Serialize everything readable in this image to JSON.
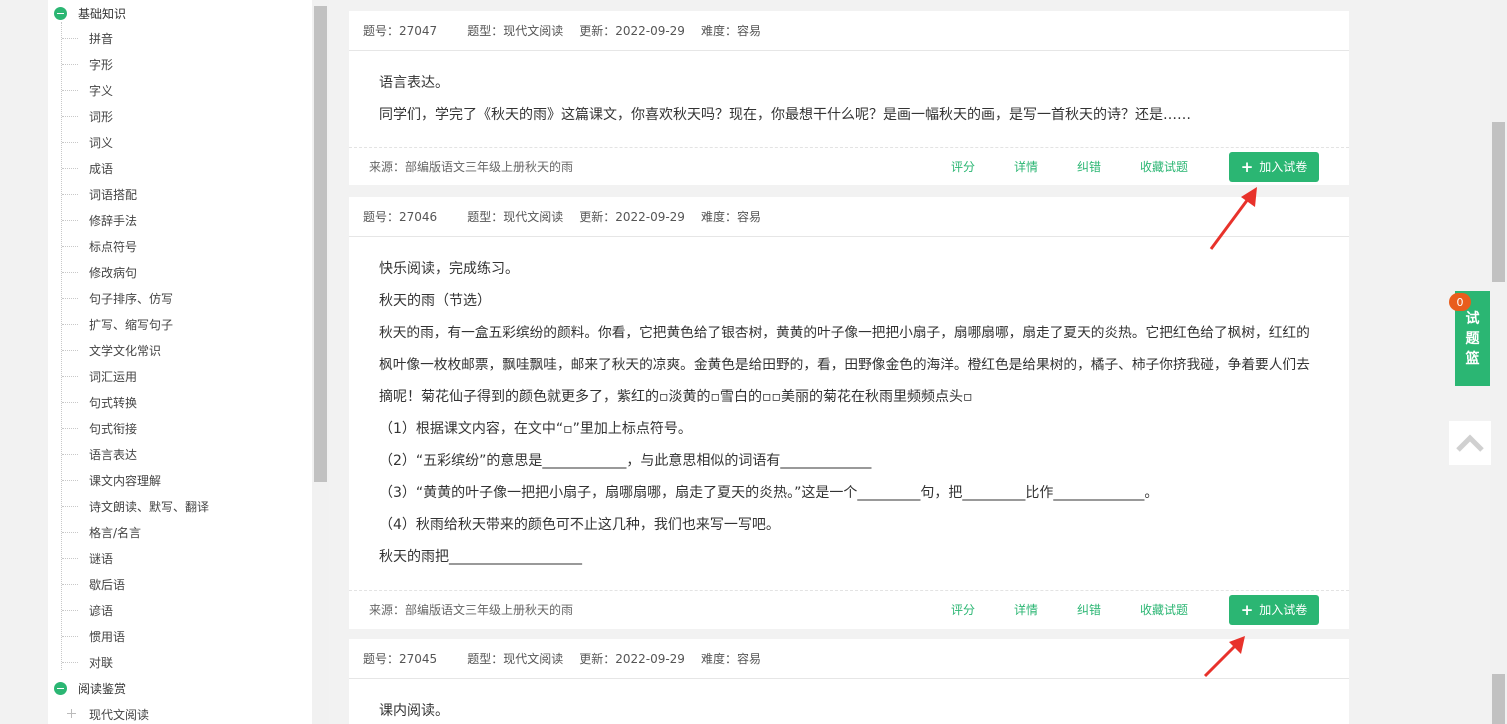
{
  "tree": {
    "categories": [
      {
        "label": "基础知识"
      },
      {
        "label": "阅读鉴赏"
      }
    ],
    "items": [
      "拼音",
      "字形",
      "字义",
      "词形",
      "词义",
      "成语",
      "词语搭配",
      "修辞手法",
      "标点符号",
      "修改病句",
      "句子排序、仿写",
      "扩写、缩写句子",
      "文学文化常识",
      "词汇运用",
      "句式转换",
      "句式衔接",
      "语言表达",
      "课文内容理解",
      "诗文朗读、默写、翻译",
      "格言/名言",
      "谜语",
      "歇后语",
      "谚语",
      "惯用语",
      "对联"
    ],
    "sub_item": "现代文阅读"
  },
  "questions": [
    {
      "id": "题号：27047",
      "type": "题型：现代文阅读",
      "update": "更新：2022-09-29",
      "difficulty": "难度：容易",
      "lines": [
        "语言表达。",
        "同学们，学完了《秋天的雨》这篇课文，你喜欢秋天吗？现在，你最想干什么呢？是画一幅秋天的画，是写一首秋天的诗？还是……"
      ],
      "source": "来源：部编版语文三年级上册秋天的雨"
    },
    {
      "id": "题号：27046",
      "type": "题型：现代文阅读",
      "update": "更新：2022-09-29",
      "difficulty": "难度：容易",
      "lines": [
        "快乐阅读，完成练习。",
        "秋天的雨（节选）",
        "秋天的雨，有一盒五彩缤纷的颜料。你看，它把黄色给了银杏树，黄黄的叶子像一把把小扇子，扇哪扇哪，扇走了夏天的炎热。它把红色给了枫树，红红的",
        "枫叶像一枚枚邮票，飘哇飘哇，邮来了秋天的凉爽。金黄色是给田野的，看，田野像金色的海洋。橙红色是给果树的，橘子、柿子你挤我碰，争着要人们去",
        "摘呢！菊花仙子得到的颜色就更多了，紫红的▫淡黄的▫雪白的▫▫美丽的菊花在秋雨里频频点头▫",
        "（1）根据课文内容，在文中“▫”里加上标点符号。",
        "（2）“五彩缤纷”的意思是____________，与此意思相似的词语有_____________",
        "（3）“黄黄的叶子像一把把小扇子，扇哪扇哪，扇走了夏天的炎热。”这是一个_________句，把_________比作_____________。",
        "（4）秋雨给秋天带来的颜色可不止这几种，我们也来写一写吧。",
        "秋天的雨把___________________"
      ],
      "source": "来源：部编版语文三年级上册秋天的雨"
    },
    {
      "id": "题号：27045",
      "type": "题型：现代文阅读",
      "update": "更新：2022-09-29",
      "difficulty": "难度：容易",
      "lines": [
        "课内阅读。"
      ]
    }
  ],
  "actions": {
    "rate": "评分",
    "details": "详情",
    "correct": "纠错",
    "favorite": "收藏试题",
    "add_plus": "+",
    "add": "加入试卷"
  },
  "basket": {
    "count": "0",
    "chars": [
      "试",
      "题",
      "篮"
    ]
  },
  "colors": {
    "accent": "#2bb673",
    "badge": "#e95d1c",
    "arrow": "#e8322b"
  }
}
